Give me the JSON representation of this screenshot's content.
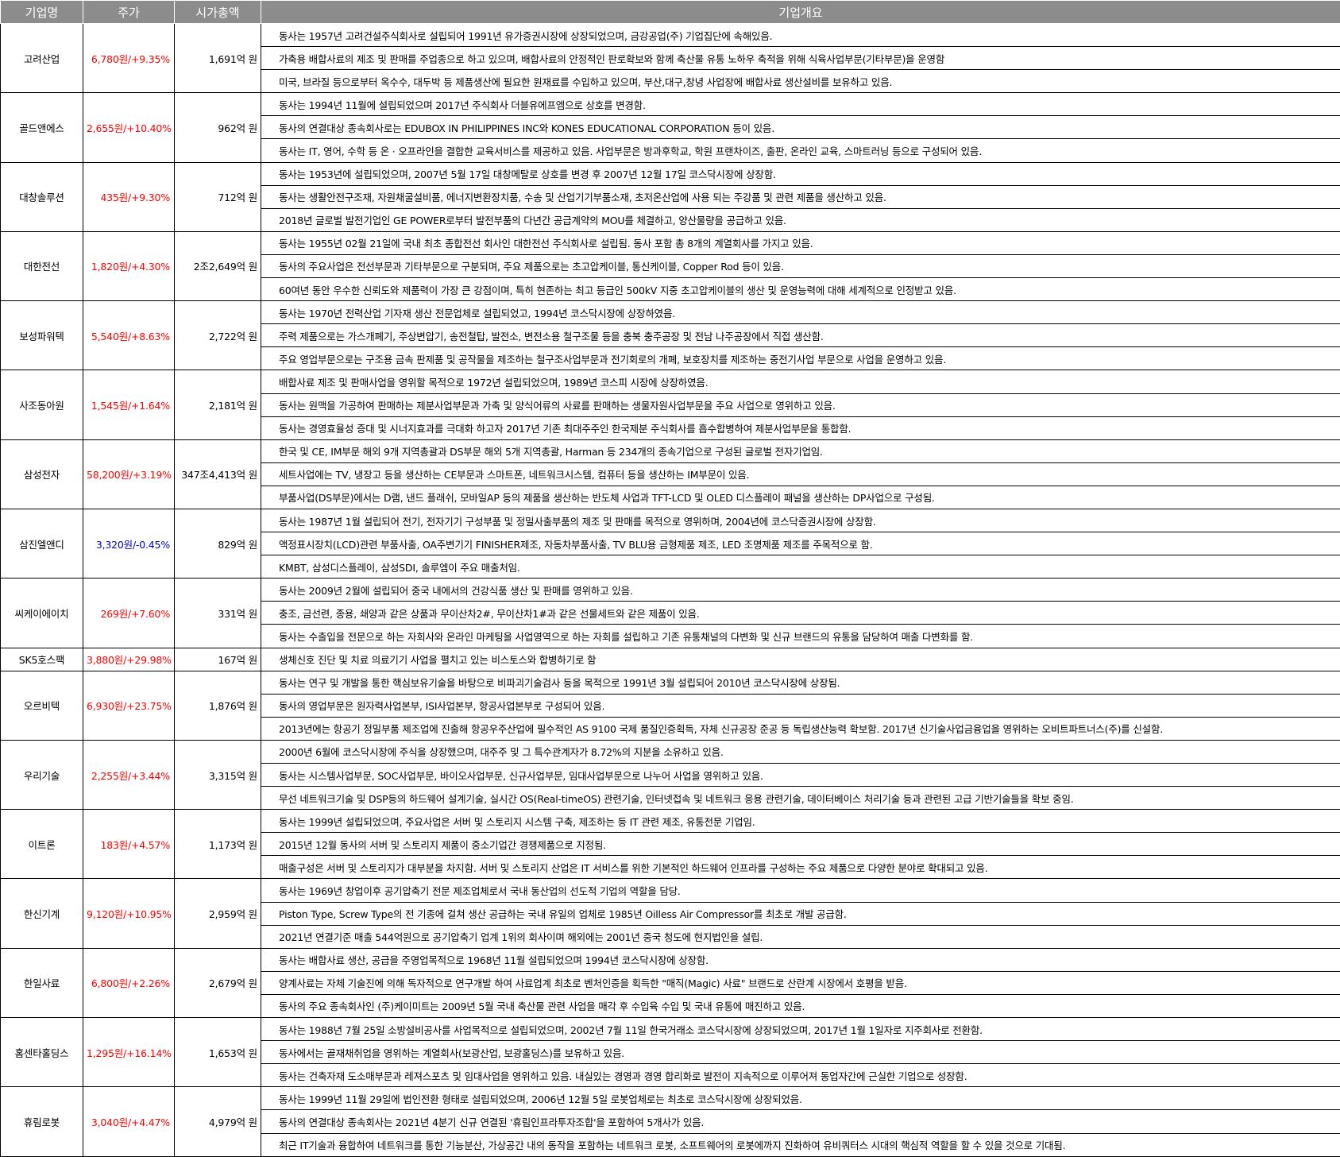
{
  "headers": [
    "기업명",
    "주가",
    "시가총액",
    "기업개요"
  ],
  "companies": [
    {
      "name": "고려산업",
      "price": "6,780원/+9.35%",
      "direction": "up",
      "cap": "1,691억 원",
      "desc": [
        "동사는 1957년 고려건설주식회사로 설립되어 1991년 유가증권시장에 상장되었으며, 금강공업(주) 기업집단에 속해있음.",
        "가축용 배합사료의 제조 및 판매를 주업종으로 하고 있으며, 배합사료의 안정적인 판로확보와 함께 축산물 유통 노하우 축적을 위해 식육사업부문(기타부문)을 운영함",
        "미국, 브라질 등으로부터 옥수수, 대두박 등 제품생산에 필요한 원재료를 수입하고 있으며, 부산,대구,창녕 사업장에 배합사료 생산설비를 보유하고 있음."
      ]
    },
    {
      "name": "골드앤에스",
      "price": "2,655원/+10.40%",
      "direction": "up",
      "cap": "962억 원",
      "desc": [
        "동사는 1994년 11월에 설립되었으며 2017년 주식회사 더블유에프엠으로 상호를 변경함.",
        "동사의 연결대상 종속회사로는 EDUBOX IN PHILIPPINES INC와 KONES EDUCATIONAL CORPORATION 등이 있음.",
        "동사는 IT, 영어, 수학 등 온 · 오프라인을 결합한 교육서비스를 제공하고 있음. 사업부문은 방과후학교, 학원 프랜차이즈, 출판, 온라인 교육, 스마트러닝 등으로 구성되어 있음."
      ]
    },
    {
      "name": "대창솔루션",
      "price": "435원/+9.30%",
      "direction": "up",
      "cap": "712억 원",
      "desc": [
        "동사는 1953년에 설립되었으며, 2007년 5월 17일 대창메탈로 상호를 변경 후 2007년 12월 17일 코스닥시장에 상장함.",
        "동사는 생활안전구조재, 자원채굴설비품, 에너지변환장치품, 수송 및 산업기기부품소재, 초저온산업에 사용 되는 주강품 및 관련 제품을 생산하고 있음.",
        "2018년 글로벌 발전기업인 GE POWER로부터 발전부품의 다년간 공급계약의 MOU를 체결하고, 양산물량을 공급하고 있음."
      ]
    },
    {
      "name": "대한전선",
      "price": "1,820원/+4.30%",
      "direction": "up",
      "cap": "2조2,649억 원",
      "desc": [
        "동사는 1955년 02월 21일에 국내 최초 종합전선 회사인 대한전선 주식회사로 설립됨. 동사 포함 총 8개의 계열회사를 가지고 있음.",
        "동사의 주요사업은 전선부문과 기타부문으로 구분되며, 주요 제품으로는 초고압케이블, 통신케이블, Copper Rod 등이 있음.",
        "60여년 동안 우수한 신뢰도와 제품력이 가장 큰 강점이며, 특히 현존하는 최고 등급인 500kV 지중 초고압케이블의 생산 및 운영능력에 대해 세계적으로 인정받고 있음."
      ]
    },
    {
      "name": "보성파워텍",
      "price": "5,540원/+8.63%",
      "direction": "up",
      "cap": "2,722억 원",
      "desc": [
        "동사는 1970년 전력산업 기자재 생산 전문업체로 설립되었고, 1994년 코스닥시장에 상장하였음.",
        "주력 제품으로는 가스개폐기, 주상변압기, 송전철탑, 발전소, 변전소용 철구조물 등을 충북 충주공장 및 전남 나주공장에서 직접 생산함.",
        "주요 영업부문으로는 구조용 금속 판제품 및 공작물을 제조하는 철구조사업부문과 전기회로의 개폐, 보호장치를 제조하는 중전기사업 부문으로 사업을 운영하고 있음."
      ]
    },
    {
      "name": "사조동아원",
      "price": "1,545원/+1.64%",
      "direction": "up",
      "cap": "2,181억 원",
      "desc": [
        "배합사료 제조 및 판매사업을 영위할 목적으로 1972년 설립되었으며, 1989년 코스피 시장에 상장하였음.",
        "동사는 원맥을 가공하여 판매하는 제분사업부문과 가축 및 양식어류의 사료를 판매하는 생물자원사업부문을 주요 사업으로 영위하고 있음.",
        "동사는 경영효율성 증대 및 시너지효과를 극대화 하고자 2017년 기존 최대주주인 한국제분 주식회사를 흡수합병하여 제분사업부문을 통합함."
      ]
    },
    {
      "name": "삼성전자",
      "price": "58,200원/+3.19%",
      "direction": "up",
      "cap": "347조4,413억 원",
      "desc": [
        "한국 및 CE, IM부문 해외 9개 지역총괄과 DS부문 해외 5개 지역총괄, Harman 등 234개의 종속기업으로 구성된 글로벌 전자기업임.",
        "세트사업에는 TV, 냉장고 등을 생산하는 CE부문과 스마트폰, 네트워크시스템, 컴퓨터 등을 생산하는 IM부문이 있음.",
        "부품사업(DS부문)에서는 D램, 낸드 플래쉬, 모바일AP 등의 제품을 생산하는 반도체 사업과 TFT-LCD 및 OLED 디스플레이 패널을 생산하는 DP사업으로 구성됨."
      ]
    },
    {
      "name": "삼진엘앤디",
      "price": "3,320원/-0.45%",
      "direction": "down",
      "cap": "829억 원",
      "desc": [
        "동사는 1987년 1월 설립되어 전기, 전자기기 구성부품 및 정밀사출부품의 제조 및 판매를 목적으로 영위하며, 2004년에 코스닥증권시장에 상장함.",
        "액정표시장치(LCD)관련 부품사출, OA주변기기 FINISHER제조, 자동차부품사출, TV BLU용 금형제품 제조, LED 조명제품 제조를 주목적으로 함.",
        "KMBT, 삼성디스플레이, 삼성SDI, 솔루엠이 주요 매출처임."
      ]
    },
    {
      "name": "씨케이에이치",
      "price": "269원/+7.60%",
      "direction": "up",
      "cap": "331억 원",
      "desc": [
        "동사는 2009년 2월에 설립되어 중국 내에서의 건강식품 생산 및  판매를 영위하고 있음.",
        "충조, 금선련, 종용, 쇄양과 같은 상품과 무이산차2#, 무이산차1#과 같은 선물세트와 같은 제품이 있음.",
        "동사는 수출입을 전문으로 하는 자회사와 온라인 마케팅을 사업영역으로 하는 자회를 설립하고 기존 유통채널의 다변화 및 신규 브랜드의 유통을 담당하여 매출 다변화를 함."
      ]
    },
    {
      "name": "SK5호스팩",
      "price": "3,880원/+29.98%",
      "direction": "up",
      "cap": "167억 원",
      "desc": [
        "생체신호 진단 및 치료 의료기기 사업을 펼치고 있는 비스토스와 합병하기로 함"
      ]
    },
    {
      "name": "오르비텍",
      "price": "6,930원/+23.75%",
      "direction": "up",
      "cap": "1,876억 원",
      "desc": [
        "동사는 연구 및 개발을 통한 핵심보유기술을 바탕으로 비파괴기술검사 등을 목적으로 1991년 3월 설립되어 2010년 코스닥시장에 상장됨.",
        "동사의 영업부문은 원자력사업본부, ISI사업본부, 항공사업본부로 구성되어 있음.",
        "2013년에는 항공기 정밀부품 제조업에 진출해 항공우주산업에 필수적인 AS 9100 국제 품질인증획득, 자체 신규공장 준공 등 독립생산능력 확보함. 2017년 신기술사업금융업을 영위하는 오비트파트너스(주)를 신설함."
      ]
    },
    {
      "name": "우리기술",
      "price": "2,255원/+3.44%",
      "direction": "up",
      "cap": "3,315억 원",
      "desc": [
        "2000년 6월에 코스닥시장에 주식을 상장했으며, 대주주 및 그 특수관계자가 8.72%의 지분을 소유하고 있음.",
        "동사는 시스템사업부문, SOC사업부문, 바이오사업부문, 신규사업부문, 임대사업부문으로 나누어 사업을 영위하고 있음.",
        "무선 네트워크기술 및 DSP등의 하드웨어 설계기술, 실시간 OS(Real-timeOS) 관련기술, 인터넷접속 및 네트워크 응용 관련기술, 데이터베이스 처리기술 등과 관련된 고급 기반기술들을 확보 중임."
      ]
    },
    {
      "name": "이트론",
      "price": "183원/+4.57%",
      "direction": "up",
      "cap": "1,173억 원",
      "desc": [
        "동사는 1999년 설립되었으며, 주요사업은 서버 및 스토리지 시스템 구축, 제조하는 등 IT 관련 제조, 유통전문 기업임.",
        "2015년 12월 동사의 서버 및 스토리지 제품이 중소기업간 경쟁제품으로 지정됨.",
        "매출구성은 서버 및 스토리지가 대부분을 차지함. 서버 및 스토리지 산업은 IT 서비스를 위한 기본적인 하드웨어 인프라를 구성하는 주요 제품으로 다양한 분야로 확대되고 있음."
      ]
    },
    {
      "name": "한신기계",
      "price": "9,120원/+10.95%",
      "direction": "up",
      "cap": "2,959억 원",
      "desc": [
        "동사는 1969년 창업이후 공기압축기 전문 제조업체로서 국내 동산업의 선도적 기업의 역할을 담당.",
        "Piston Type, Screw Type의 전 기종에 걸쳐 생산 공급하는 국내 유일의 업체로 1985년 Oilless Air Compressor를 최초로 개발 공급함.",
        "2021년 연결기준 매출 544억원으로 공기압축기 업계 1위의 회사이며 해외에는 2001년 중국 청도에 현지법인을 설립."
      ]
    },
    {
      "name": "한일사료",
      "price": "6,800원/+2.26%",
      "direction": "up",
      "cap": "2,679억 원",
      "desc": [
        "동사는 배합사료 생산, 공급을 주영업목적으로 1968년 11월 설립되었으며 1994년 코스닥시장에 상장함.",
        "양계사료는 자체 기술진에 의해 독자적으로 연구개발   하여 사료업계 최초로 벤처인증을 획득한 \"매직(Magic) 사료\" 브랜드로 산란계 시장에서 호평을 받음.",
        "동사의 주요 종속회사인 (주)케이미트는 2009년 5월 국내 축산물 관련 사업을 매각 후 수입육 수입 및 국내 유통에 매진하고 있음."
      ]
    },
    {
      "name": "홈센타홀딩스",
      "price": "1,295원/+16.14%",
      "direction": "up",
      "cap": "1,653억 원",
      "desc": [
        "동사는 1988년 7월 25일 소방설비공사를 사업목적으로 설립되었으며, 2002년 7월 11일 한국거래소 코스닥시장에 상장되었으며, 2017년 1월 1일자로 지주회사로 전환함.",
        "동사에서는 골재채취업을 영위하는 계열회사(보광산업, 보광홀딩스)를 보유하고 있음.",
        "동사는 건축자재 도소매부문과 레져스포츠 및 임대사업을 영위하고 있음. 내실있는 경영과 경영 합리화로 발전이 지속적으로 이루어져 동업자간에 근실한 기업으로 성장함."
      ]
    },
    {
      "name": "휴림로봇",
      "price": "3,040원/+4.47%",
      "direction": "up",
      "cap": "4,979억 원",
      "desc": [
        "동사는 1999년 11월 29일에 법인전환 형태로 설립되었으며, 2006년 12월 5일 로봇업체로는 최초로 코스닥시장에 상장되었음.",
        "동사의 연결대상 종속회사는 2021년 4분기 신규 연결된 '휴림인프라투자조합'을 포함하여 5개사가 있음.",
        "최근 IT기술과 융합하여 네트워크를 통한 기능분산, 가상공간 내의 동작을 포함하는 네트워크 로봇, 소프트웨어의 로봇에까지 진화하여 유비쿼터스 시대의 핵심적 역할을 할 수 있을 것으로 기대됨."
      ]
    }
  ]
}
